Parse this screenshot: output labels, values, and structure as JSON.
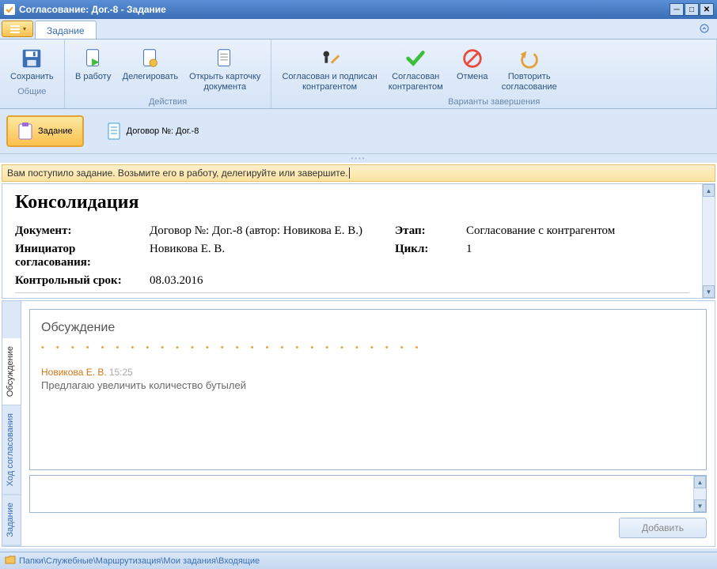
{
  "window": {
    "title": "Согласование: Дог.-8 - Задание"
  },
  "tabs": {
    "main": "Задание"
  },
  "ribbon": {
    "groups": {
      "common": {
        "label": "Общие",
        "save": "Сохранить"
      },
      "actions": {
        "label": "Действия",
        "take": "В работу",
        "delegate": "Делегировать",
        "open_card": "Открыть карточку\nдокумента"
      },
      "completion": {
        "label": "Варианты завершения",
        "signed": "Согласован и подписан\nконтрагентом",
        "agreed": "Согласован\nконтрагентом",
        "cancel": "Отмена",
        "repeat": "Повторить\nсогласование"
      }
    }
  },
  "docbar": {
    "task": "Задание",
    "doc": "Договор №: Дог.-8"
  },
  "hint": "Вам поступило задание. Возьмите его в работу, делегируйте или завершите.",
  "info": {
    "title": "Консолидация",
    "labels": {
      "document": "Документ:",
      "stage": "Этап:",
      "initiator": "Инициатор согласования:",
      "cycle": "Цикл:",
      "deadline": "Контрольный срок:"
    },
    "values": {
      "document": "Договор №: Дог.-8 (автор: Новикова Е. В.)",
      "stage": "Согласование с контрагентом",
      "initiator": "Новикова Е. В.",
      "cycle": "1",
      "deadline": "08.03.2016"
    }
  },
  "side_tabs": {
    "task": "Задание",
    "progress": "Ход согласования",
    "discussion": "Обсуждение"
  },
  "discussion": {
    "title": "Обсуждение",
    "messages": [
      {
        "author": "Новикова Е. В.",
        "time": "15:25",
        "text": "Предлагаю увеличить количество бутылей"
      }
    ],
    "add_button": "Добавить",
    "input_value": ""
  },
  "statusbar": {
    "path": "Папки\\Служебные\\Маршрутизация\\Мои задания\\Входящие"
  }
}
